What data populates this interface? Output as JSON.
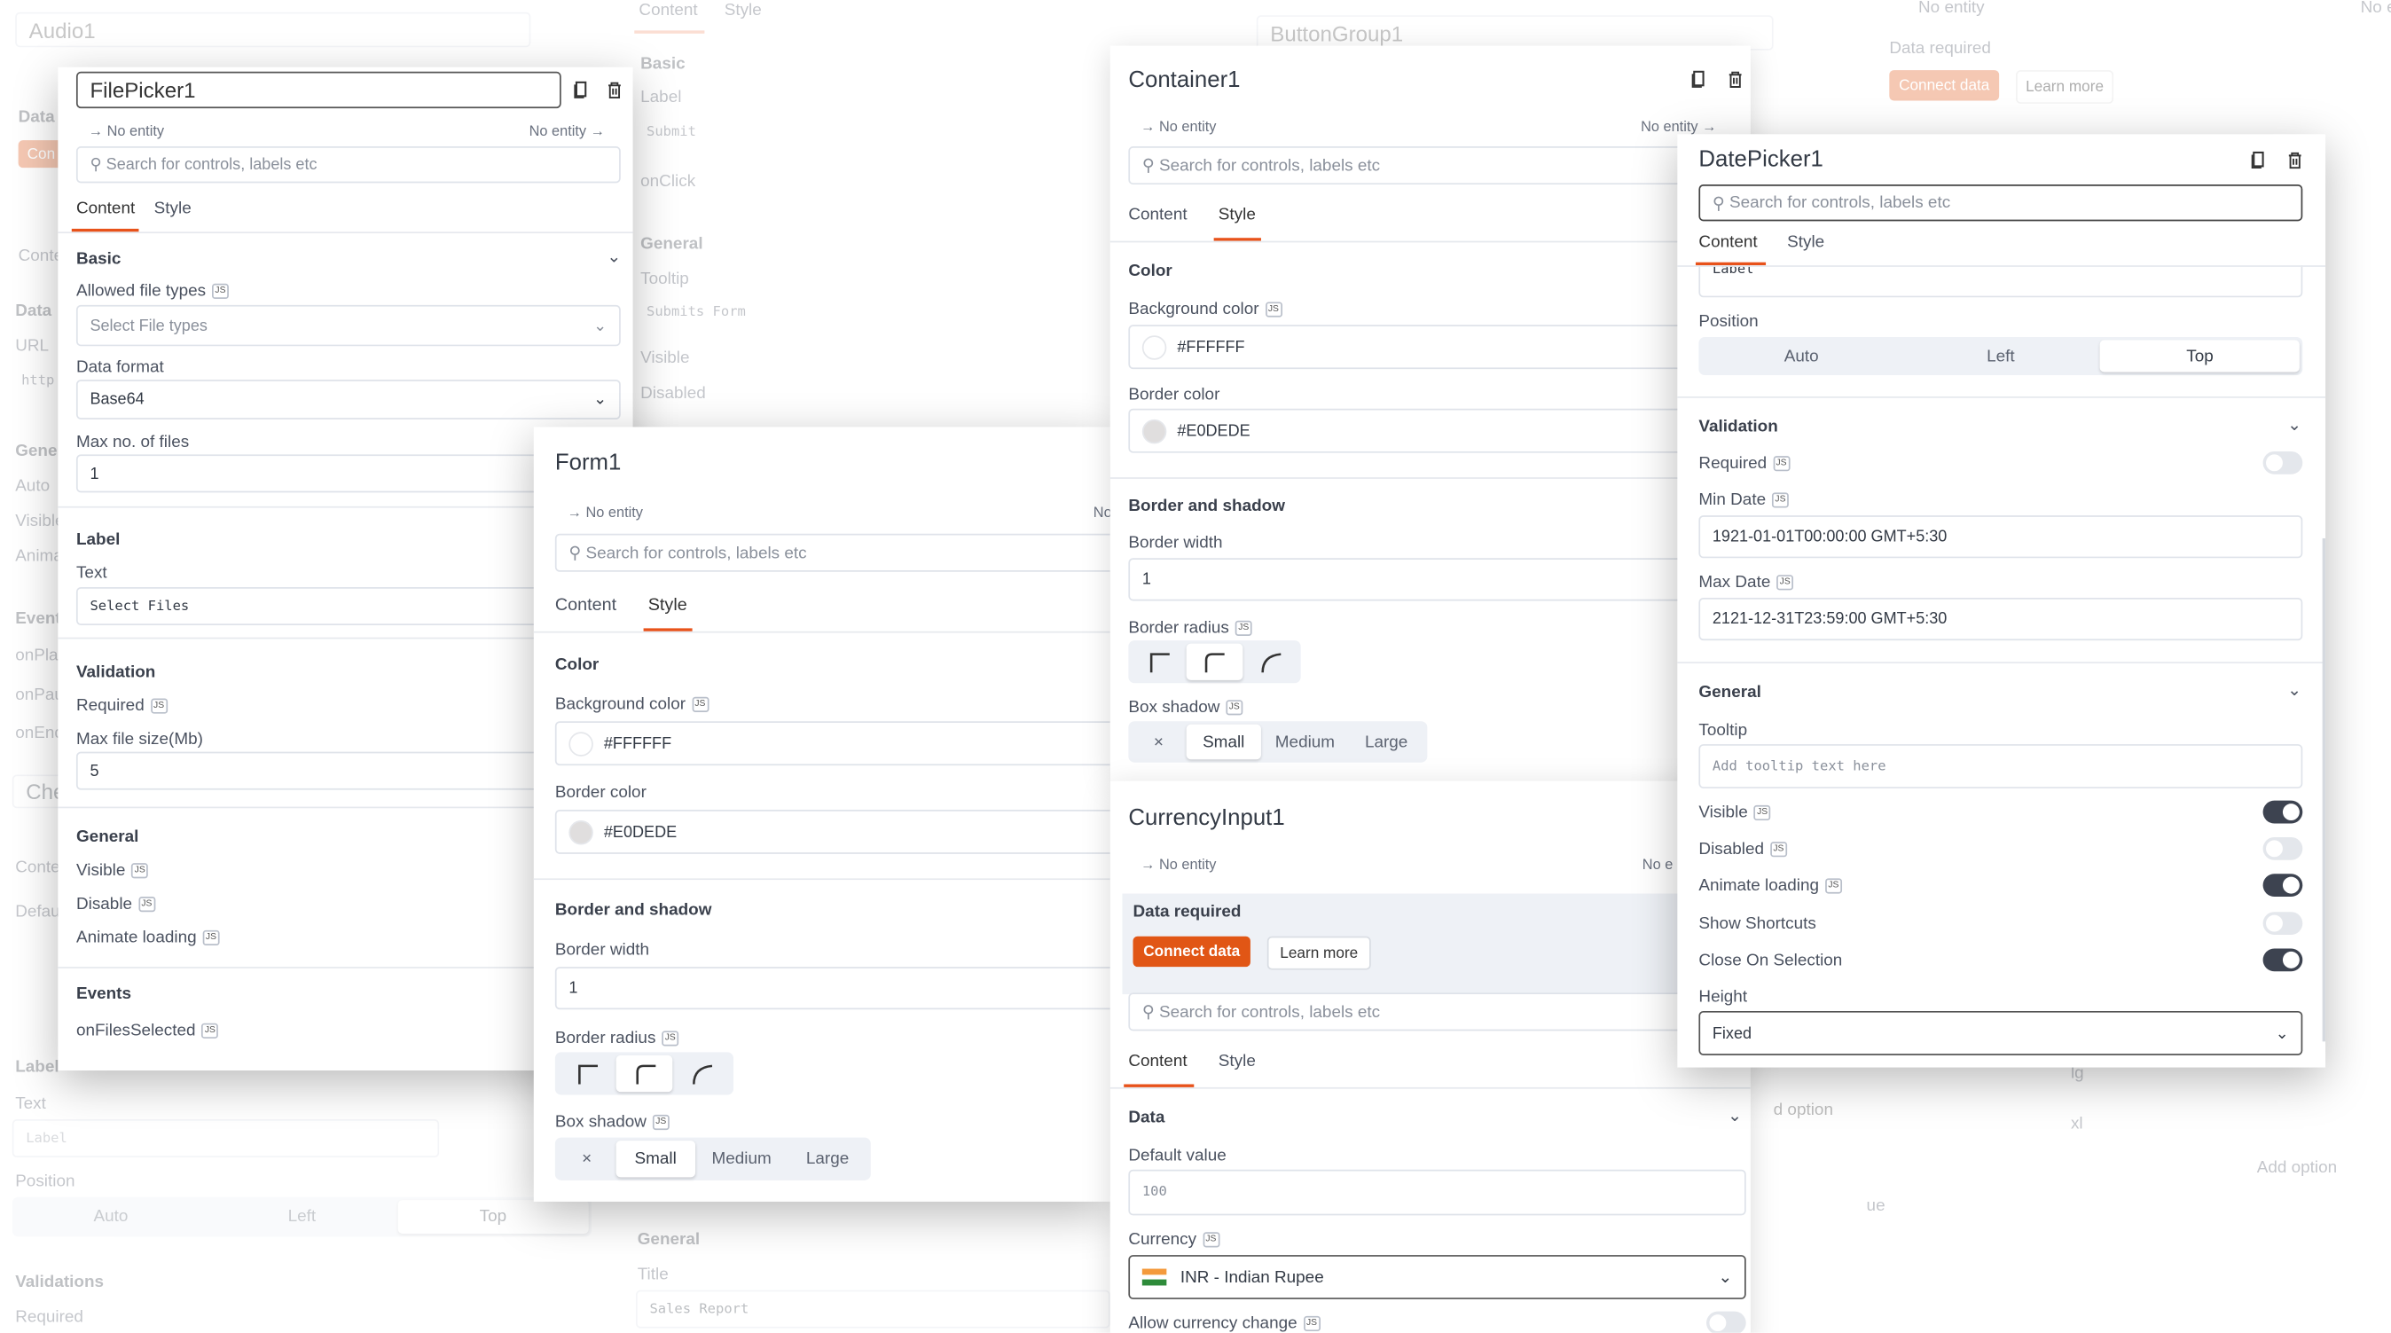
{
  "common": {
    "no_entity": "No entity",
    "search_placeholder": "Search for controls, labels etc",
    "tab_content": "Content",
    "tab_style": "Style",
    "js": "JS"
  },
  "colors": {
    "accent": "#E8521A",
    "connect_button": "#E15615",
    "toggle_on": "#3D4350"
  },
  "background": {
    "audio_title": "Audio1",
    "audio_items": [
      "Data",
      "Con",
      "Conte",
      "Data",
      "URL",
      "http",
      "General",
      "Auto",
      "Visible",
      "Anima",
      "Events",
      "onPla",
      "onPau",
      "onEnd",
      "Chec",
      "Conte",
      "Defau",
      "Label",
      "Text",
      "Label",
      "Position",
      "Auto",
      "Left",
      "Top",
      "Validations",
      "Required"
    ],
    "button_items": [
      "Content",
      "Style",
      "Basic",
      "Label",
      "Submit",
      "onClick",
      "General",
      "Tooltip",
      "Submits Form",
      "Visible",
      "Disabled",
      "General",
      "Title",
      "Sales Report"
    ],
    "buttongroup_title": "ButtonGroup1",
    "right_items": [
      "No entity",
      "Data required",
      "Connect data",
      "Learn more",
      "d option",
      "lg",
      "xl",
      "Add option",
      "ue",
      "No entity"
    ]
  },
  "filepicker": {
    "title": "FilePicker1",
    "no_entity_right": "No entity",
    "active_tab": "Content",
    "basic": "Basic",
    "allowed_file_types": "Allowed file types",
    "allowed_placeholder": "Select File types",
    "data_format": "Data format",
    "data_format_value": "Base64",
    "max_files": "Max no. of files",
    "max_files_value": "1",
    "label_section": "Label",
    "text": "Text",
    "text_value": "Select Files",
    "validation": "Validation",
    "required": "Required",
    "max_size": "Max file size(Mb)",
    "max_size_value": "5",
    "general": "General",
    "visible": "Visible",
    "disable": "Disable",
    "animate": "Animate loading",
    "events": "Events",
    "on_files": "onFilesSelected"
  },
  "form": {
    "title": "Form1",
    "active_tab": "Style",
    "color": "Color",
    "bg_color": "Background color",
    "bg_value": "#FFFFFF",
    "border_color": "Border color",
    "border_value": "#E0DEDE",
    "border_shadow": "Border and shadow",
    "border_width": "Border width",
    "border_width_value": "1",
    "border_radius": "Border radius",
    "box_shadow": "Box shadow",
    "shadow_options": [
      "×",
      "Small",
      "Medium",
      "Large"
    ],
    "shadow_selected": "Small",
    "no_entity_right": "No"
  },
  "container": {
    "title": "Container1",
    "no_entity_right": "No entity",
    "active_tab": "Style",
    "color": "Color",
    "bg_color": "Background color",
    "bg_value": "#FFFFFF",
    "border_color": "Border color",
    "border_value": "#E0DEDE",
    "border_shadow": "Border and shadow",
    "border_width": "Border width",
    "border_width_value": "1",
    "border_radius": "Border radius",
    "box_shadow": "Box shadow",
    "shadow_options": [
      "×",
      "Small",
      "Medium",
      "Large"
    ]
  },
  "currency": {
    "title": "CurrencyInput1",
    "no_entity_right": "No e",
    "data_required": "Data required",
    "connect": "Connect data",
    "learn": "Learn more",
    "active_tab": "Content",
    "data": "Data",
    "default_value": "Default value",
    "default_placeholder": "100",
    "currency": "Currency",
    "currency_value": "INR - Indian Rupee",
    "allow_change": "Allow currency change"
  },
  "datepicker": {
    "title": "DatePicker1",
    "active_tab": "Content",
    "label_value": "Label",
    "position": "Position",
    "position_options": [
      "Auto",
      "Left",
      "Top"
    ],
    "position_selected": "Top",
    "validation": "Validation",
    "required": "Required",
    "required_on": false,
    "min_date": "Min Date",
    "min_date_value": "1921-01-01T00:00:00 GMT+5:30",
    "max_date": "Max Date",
    "max_date_value": "2121-12-31T23:59:00 GMT+5:30",
    "general": "General",
    "tooltip": "Tooltip",
    "tooltip_placeholder": "Add tooltip text here",
    "toggles": [
      {
        "label": "Visible",
        "js": true,
        "on": true
      },
      {
        "label": "Disabled",
        "js": true,
        "on": false
      },
      {
        "label": "Animate loading",
        "js": true,
        "on": true
      },
      {
        "label": "Show Shortcuts",
        "js": false,
        "on": false
      },
      {
        "label": "Close On Selection",
        "js": false,
        "on": true
      }
    ],
    "height": "Height",
    "height_value": "Fixed"
  }
}
